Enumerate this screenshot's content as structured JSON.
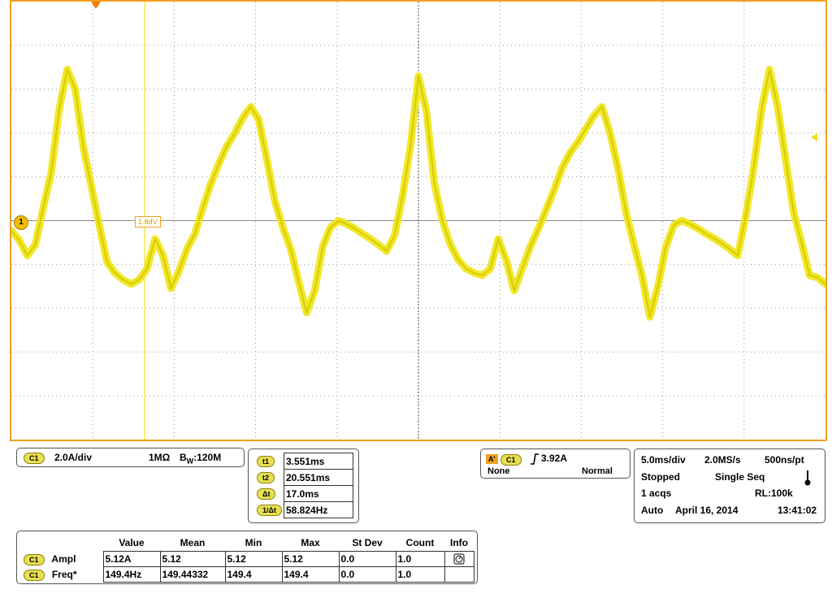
{
  "colors": {
    "trace": "#f0e61e",
    "frame": "#f0a020",
    "grid": "#999999"
  },
  "screen": {
    "channel_marker": "1",
    "cursor_label": "1.8dV",
    "waveform_samples": [
      -0.23,
      -0.45,
      -0.8,
      -0.55,
      0.3,
      1.1,
      2.55,
      3.45,
      3.0,
      1.7,
      0.8,
      -0.1,
      -0.95,
      -1.2,
      -1.35,
      -1.45,
      -1.35,
      -1.1,
      -0.42,
      -0.8,
      -1.55,
      -1.15,
      -0.65,
      -0.3,
      0.3,
      0.85,
      1.3,
      1.7,
      2.0,
      2.35,
      2.6,
      2.3,
      1.4,
      0.45,
      -0.15,
      -0.65,
      -1.4,
      -2.1,
      -1.6,
      -0.6,
      -0.15,
      0.0,
      -0.08,
      -0.18,
      -0.3,
      -0.42,
      -0.55,
      -0.7,
      -0.35,
      0.55,
      1.7,
      3.3,
      2.5,
      0.85,
      0.0,
      -0.55,
      -0.9,
      -1.1,
      -1.2,
      -1.25,
      -1.1,
      -0.42,
      -0.9,
      -1.6,
      -1.1,
      -0.6,
      -0.2,
      0.25,
      0.7,
      1.2,
      1.55,
      1.8,
      2.1,
      2.4,
      2.6,
      2.0,
      1.2,
      0.2,
      -0.55,
      -1.25,
      -2.2,
      -1.5,
      -0.6,
      -0.1,
      0.0,
      -0.08,
      -0.18,
      -0.3,
      -0.4,
      -0.52,
      -0.65,
      -0.8,
      0.1,
      1.2,
      2.55,
      3.45,
      2.6,
      1.4,
      0.2,
      -0.5,
      -1.25,
      -1.3,
      -1.45
    ]
  },
  "channel_panel": {
    "pill": "C1",
    "scale": "2.0A/div",
    "impedance": "1MΩ",
    "bandwidth_prefix": "B",
    "bandwidth_sub": "W",
    "bandwidth": ":120M"
  },
  "cursors": [
    {
      "pill": "t1",
      "value": "3.551ms"
    },
    {
      "pill": "t2",
      "value": "20.551ms"
    },
    {
      "pill": "Δt",
      "value": "17.0ms"
    },
    {
      "pill": "1/Δt",
      "value": "58.824Hz"
    }
  ],
  "trigger_panel": {
    "pill_a": "A'",
    "pill_c": "C1",
    "slope_icon": "rising-edge-icon",
    "level": "3.92A",
    "coupling": "None",
    "mode": "Normal"
  },
  "acquisition": {
    "timebase": "5.0ms/div",
    "sample_rate": "2.0MS/s",
    "resolution": "500ns/pt",
    "state": "Stopped",
    "sequence": "Single Seq",
    "acqs": "1 acqs",
    "record_length": "RL:100k",
    "trigger_mode": "Auto",
    "date": "April 16, 2014",
    "time": "13:41:02"
  },
  "measurements": {
    "headers": [
      "Value",
      "Mean",
      "Min",
      "Max",
      "St Dev",
      "Count",
      "Info"
    ],
    "rows": [
      {
        "pill": "C1",
        "name": "Ampl",
        "value": "5.12A",
        "mean": "5.12",
        "min": "5.12",
        "max": "5.12",
        "stdev": "0.0",
        "count": "1.0"
      },
      {
        "pill": "C1",
        "name": "Freq*",
        "value": "149.4Hz",
        "mean": "149.44332",
        "min": "149.4",
        "max": "149.4",
        "stdev": "0.0",
        "count": "1.0"
      }
    ]
  }
}
